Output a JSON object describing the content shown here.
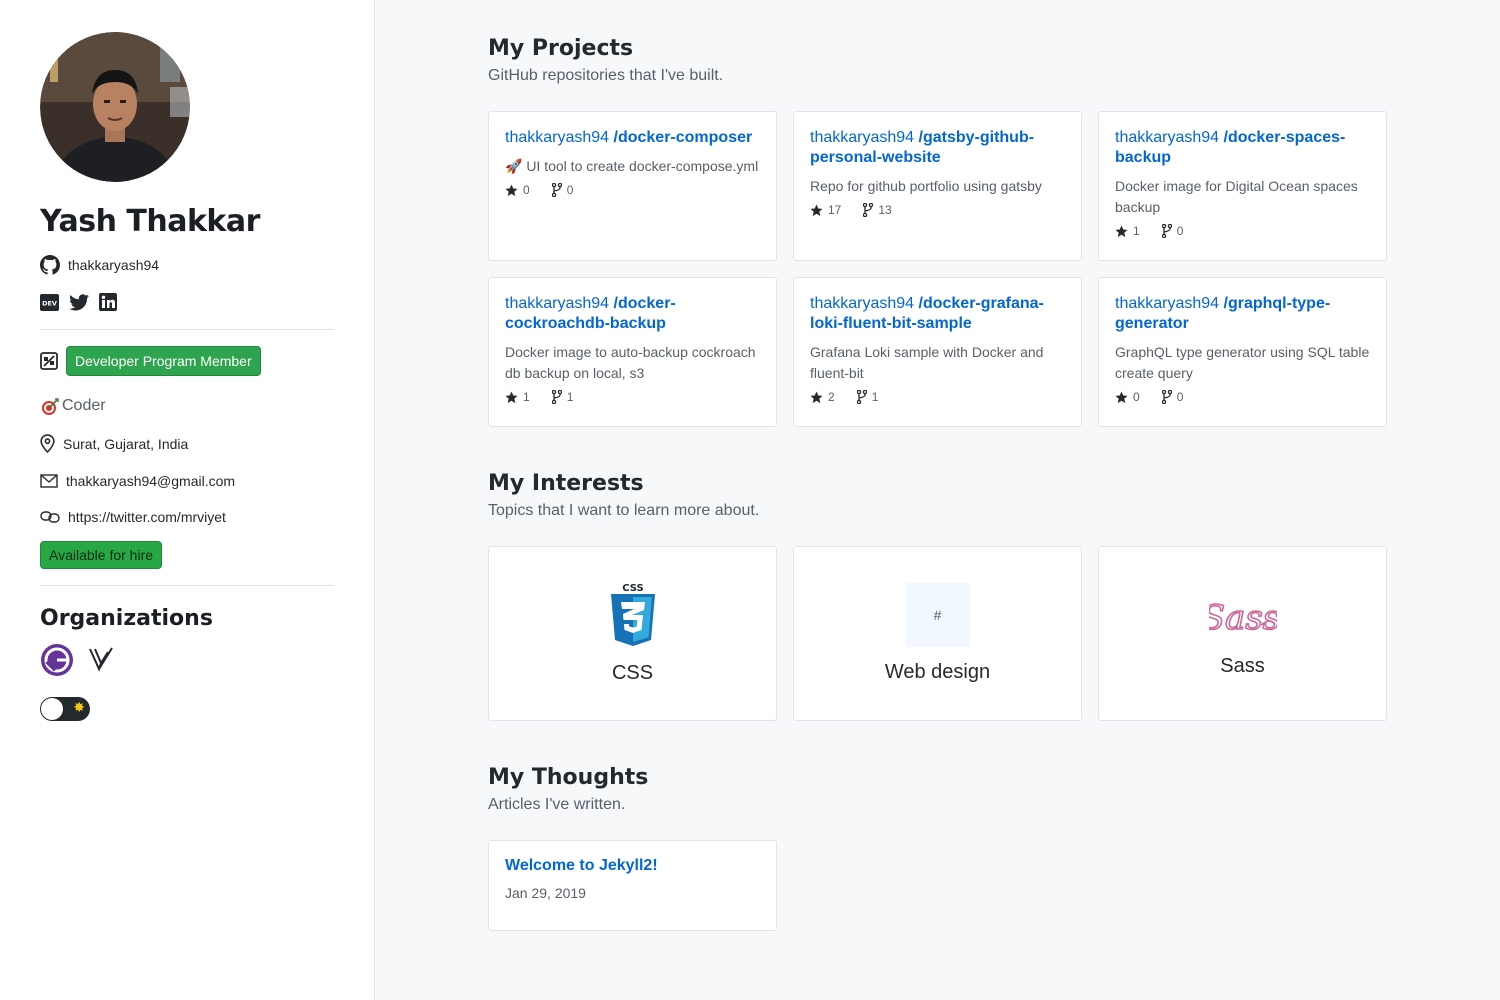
{
  "profile": {
    "name": "Yash Thakkar",
    "github_username": "thakkaryash94",
    "program_badge": "Developer Program Member",
    "bio": "Coder",
    "bio_icon": "target-icon",
    "location": "Surat, Gujarat, India",
    "email": "thakkaryash94@gmail.com",
    "website": "https://twitter.com/mrviyet",
    "hire_label": "Available for hire",
    "social": [
      "dev-icon",
      "twitter-icon",
      "linkedin-icon"
    ]
  },
  "organizations": {
    "title": "Organizations",
    "items": [
      "gatsby-logo",
      "vercel-logo"
    ]
  },
  "projects": {
    "title": "My Projects",
    "subtitle": "GitHub repositories that I've built.",
    "repos": [
      {
        "owner": "thakkaryash94",
        "name": "/docker-composer",
        "desc": "🚀 UI tool to create docker-compose.yml",
        "stars": "0",
        "forks": "0"
      },
      {
        "owner": "thakkaryash94",
        "name": "/gatsby-github-personal-website",
        "desc": "Repo for github portfolio using gatsby",
        "stars": "17",
        "forks": "13"
      },
      {
        "owner": "thakkaryash94",
        "name": "/docker-spaces-backup",
        "desc": "Docker image for Digital Ocean spaces backup",
        "stars": "1",
        "forks": "0"
      },
      {
        "owner": "thakkaryash94",
        "name": "/docker-cockroachdb-backup",
        "desc": "Docker image to auto-backup cockroach db backup on local, s3",
        "stars": "1",
        "forks": "1"
      },
      {
        "owner": "thakkaryash94",
        "name": "/docker-grafana-loki-fluent-bit-sample",
        "desc": "Grafana Loki sample with Docker and fluent-bit",
        "stars": "2",
        "forks": "1"
      },
      {
        "owner": "thakkaryash94",
        "name": "/graphql-type-generator",
        "desc": "GraphQL type generator using SQL table create query",
        "stars": "0",
        "forks": "0"
      }
    ]
  },
  "interests": {
    "title": "My Interests",
    "subtitle": "Topics that I want to learn more about.",
    "items": [
      {
        "label": "CSS",
        "icon": "css3-icon"
      },
      {
        "label": "Web design",
        "icon_text": "#"
      },
      {
        "label": "Sass",
        "icon": "sass-icon",
        "icon_text": "Sass"
      }
    ]
  },
  "thoughts": {
    "title": "My Thoughts",
    "subtitle": "Articles I've written.",
    "posts": [
      {
        "title": "Welcome to Jekyll2!",
        "date": "Jan 29, 2019"
      }
    ]
  },
  "colors": {
    "link": "#0366d6",
    "badge_green": "#2ea44f",
    "muted": "#586069"
  }
}
